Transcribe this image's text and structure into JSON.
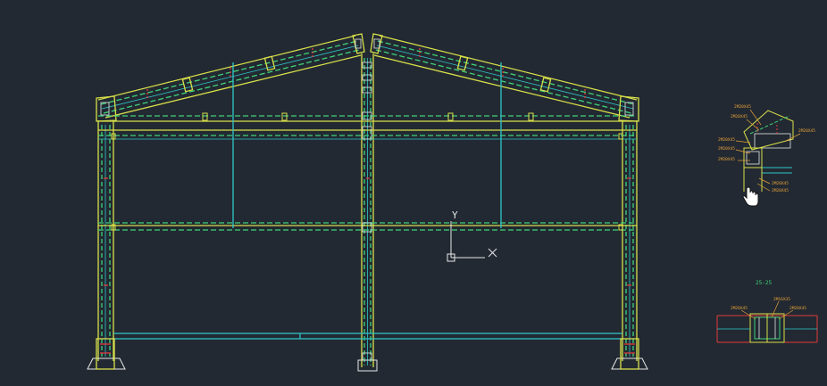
{
  "drawing": {
    "colors": {
      "background": "#222932",
      "frame_yellow": "#d8e04a",
      "frame_green": "#3fd37a",
      "frame_cyan": "#2fc7c9",
      "red_marks": "#e23a3a",
      "white": "#e8e8e8",
      "orange": "#e8a23a"
    },
    "ucs": {
      "y_label": "Y",
      "x_label": "X"
    },
    "detail_top": {
      "labels": [
        "2M20X45",
        "2M20X45",
        "2M20X45",
        "2M20X45",
        "2M20X45",
        "2M20X45",
        "2M20X45",
        "2M20X45"
      ]
    },
    "detail_bottom": {
      "section_label": "25-25",
      "labels": [
        "2M20X45",
        "2M16X35",
        "2M20X45"
      ]
    },
    "cursor": {
      "icon": "hand-cursor-icon"
    }
  }
}
